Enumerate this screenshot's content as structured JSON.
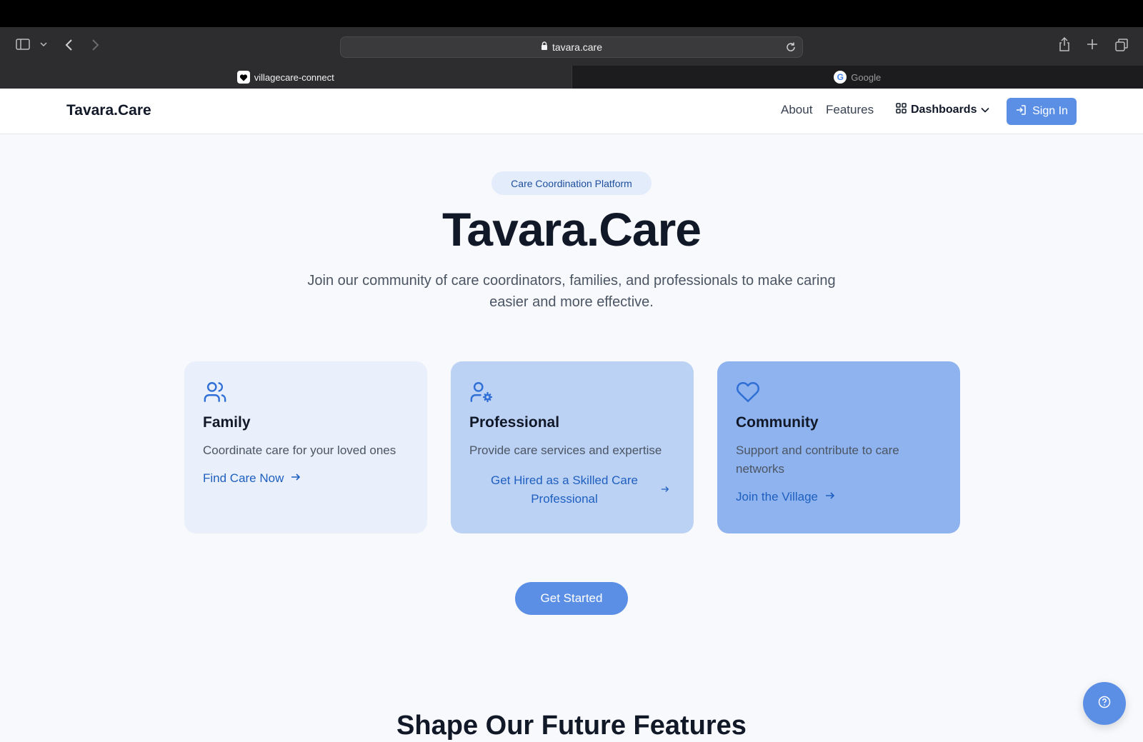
{
  "browser": {
    "url": "tavara.care",
    "tabs": [
      {
        "label": "villagecare-connect",
        "active": true
      },
      {
        "label": "Google",
        "active": false
      }
    ]
  },
  "header": {
    "brand": "Tavara.Care",
    "nav": [
      "About",
      "Features"
    ],
    "dashboards_label": "Dashboards",
    "signin_label": "Sign In"
  },
  "hero": {
    "badge": "Care Coordination Platform",
    "title": "Tavara.Care",
    "subtitle": "Join our community of care coordinators, families, and professionals to make caring easier and more effective."
  },
  "cards": [
    {
      "icon": "users-icon",
      "title": "Family",
      "description": "Coordinate care for your loved ones",
      "cta": "Find Care Now",
      "bg": "#e9f0fb"
    },
    {
      "icon": "user-gear-icon",
      "title": "Professional",
      "description": "Provide care services and expertise",
      "cta": "Get Hired as a Skilled Care Professional",
      "bg": "#bcd2f5"
    },
    {
      "icon": "heart-icon",
      "title": "Community",
      "description": "Support and contribute to care networks",
      "cta": "Join the Village",
      "bg": "#8fb3ee"
    }
  ],
  "get_started_label": "Get Started",
  "section_title": "Shape Our Future Features",
  "colors": {
    "accent": "#5b8fe6",
    "link": "#1e5fbf",
    "text": "#111827"
  }
}
